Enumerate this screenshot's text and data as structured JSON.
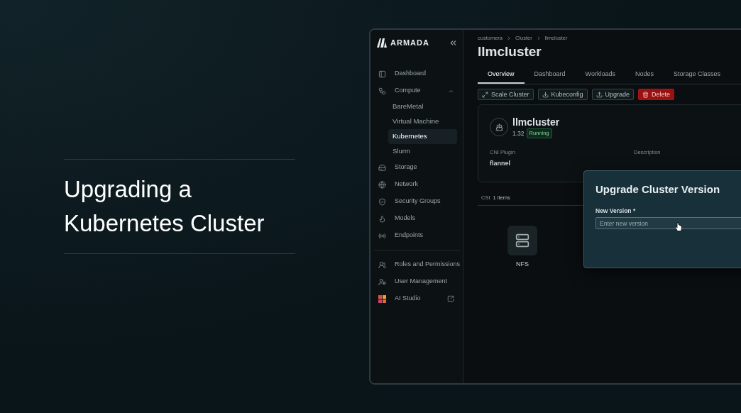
{
  "headline": {
    "lines": [
      "Upgrading a",
      "Kubernetes Cluster"
    ]
  },
  "app": {
    "brand": "ARMADA",
    "sidebar": {
      "items": [
        {
          "label": "Dashboard",
          "selected": false
        },
        {
          "label": "Compute",
          "expanded": true,
          "selected": false,
          "children": [
            {
              "label": "BareMetal",
              "selected": false
            },
            {
              "label": "Virtual Machine",
              "selected": false
            },
            {
              "label": "Kubernetes",
              "selected": true
            },
            {
              "label": "Slurm",
              "selected": false
            }
          ]
        },
        {
          "label": "Storage",
          "selected": false
        },
        {
          "label": "Network",
          "selected": false
        },
        {
          "label": "Security Groups",
          "selected": false
        },
        {
          "label": "Models",
          "selected": false
        },
        {
          "label": "Endpoints",
          "selected": false
        }
      ],
      "admin_items": [
        {
          "label": "Roles and Permissions",
          "selected": false
        },
        {
          "label": "User Management",
          "selected": false
        },
        {
          "label": "AI Studio",
          "selected": false,
          "external": true
        }
      ]
    },
    "breadcrumb": [
      "customera",
      "Cluster",
      "llmcluster"
    ],
    "title": "llmcluster",
    "tabs": [
      {
        "label": "Overview",
        "selected": true
      },
      {
        "label": "Dashboard",
        "selected": false
      },
      {
        "label": "Workloads",
        "selected": false
      },
      {
        "label": "Nodes",
        "selected": false
      },
      {
        "label": "Storage Classes",
        "selected": false
      }
    ],
    "actions": [
      {
        "label": "Scale Cluster",
        "kind": "outline"
      },
      {
        "label": "Kubeconfig",
        "kind": "outline"
      },
      {
        "label": "Upgrade",
        "kind": "outline"
      },
      {
        "label": "Delete",
        "kind": "danger"
      }
    ],
    "card": {
      "name": "llmcluster",
      "version": "1.32",
      "status": "Running",
      "fields": [
        {
          "label": "CNI Plugin",
          "value": "flannel"
        },
        {
          "label": "Description"
        }
      ]
    },
    "csi": {
      "label": "CSI",
      "count": "1 items",
      "items": [
        {
          "name": "NFS"
        }
      ]
    },
    "dialog": {
      "title": "Upgrade Cluster Version",
      "field_label": "New Version *",
      "placeholder": "Enter new version"
    }
  }
}
